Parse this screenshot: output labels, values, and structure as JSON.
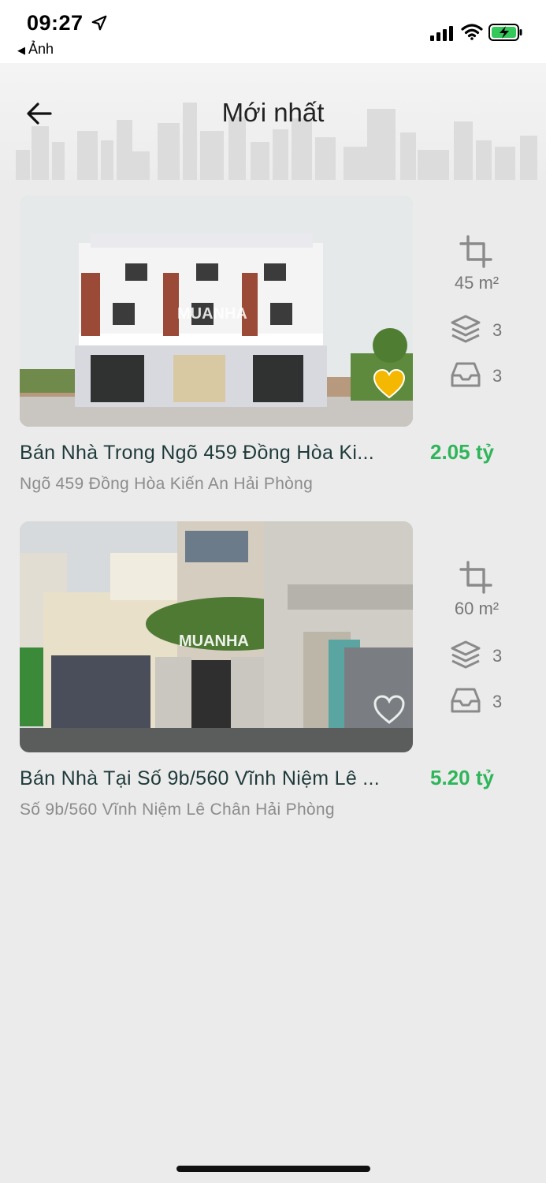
{
  "status_bar": {
    "time": "09:27",
    "back_app_label": "Ảnh",
    "battery_color": "#34c759"
  },
  "header": {
    "title": "Mới nhất"
  },
  "listings": [
    {
      "title": "Bán Nhà Trong Ngõ 459 Đồng Hòa Ki...",
      "price": "2.05 tỷ",
      "address": "Ngõ 459 Đồng Hòa Kiến An Hải Phòng",
      "area": "45 m²",
      "floors": "3",
      "rooms": "3",
      "favorited": true,
      "watermark": "MUANHA"
    },
    {
      "title": "Bán Nhà Tại Số 9b/560 Vĩnh Niệm Lê ...",
      "price": "5.20 tỷ",
      "address": "Số 9b/560 Vĩnh Niệm Lê Chân Hải Phòng",
      "area": "60 m²",
      "floors": "3",
      "rooms": "3",
      "favorited": false,
      "watermark": "MUANHA"
    }
  ],
  "colors": {
    "price": "#2fb55a",
    "favorite_active": "#f5b800",
    "background": "#ebebeb"
  }
}
